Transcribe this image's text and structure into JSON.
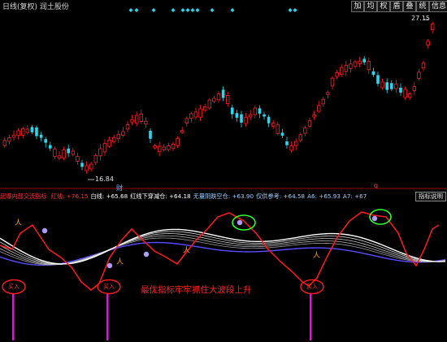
{
  "window": {
    "title": "日线(复权)  润土股份"
  },
  "toolbar": {
    "buttons": [
      {
        "label": "加",
        "name": "add-button"
      },
      {
        "label": "均",
        "name": "average-button"
      },
      {
        "label": "权",
        "name": "rights-button"
      },
      {
        "label": "盾",
        "name": "shield-button"
      },
      {
        "label": "叠",
        "name": "overlay-button"
      },
      {
        "label": "统",
        "name": "stats-button"
      },
      {
        "label": "信息",
        "name": "info-button"
      }
    ]
  },
  "price_chart": {
    "high_label": "27.15",
    "low_label": "16.84",
    "event_mark_1": "财",
    "event_mark_2": "q",
    "colors": {
      "up": "#ff2020",
      "down": "#2ad6f0",
      "background": "#000000"
    }
  },
  "indicator": {
    "name": "起爆内部交流指标",
    "items": [
      {
        "label": "红线:",
        "value": "+76.15",
        "color": "#ff3030"
      },
      {
        "label": "白线:",
        "value": "+65.68",
        "color": "#ffffff"
      },
      {
        "label": "红线下穿减仓:",
        "value": "+64.18",
        "color": "#ffffff"
      },
      {
        "label": "无量阴跌空仓:",
        "value": "+63.90",
        "color": "#9ad0ff"
      },
      {
        "label": "仅供参考:",
        "value": "+64.58",
        "color": "#9ad0ff"
      },
      {
        "label": "A6:",
        "value": "+65.93",
        "color": "#9ad0ff"
      },
      {
        "label": "A7:",
        "value": "+67",
        "color": "#9ad0ff"
      }
    ],
    "explain_button": "指标说明",
    "signal_label": "买入",
    "annotation": "最优指标牢牢抓住大波段上升",
    "colors": {
      "red_line": "#ff1a1a",
      "white_line": "#ffffff",
      "blue_line": "#5a4cff",
      "signal": "#ff00ff"
    }
  }
}
